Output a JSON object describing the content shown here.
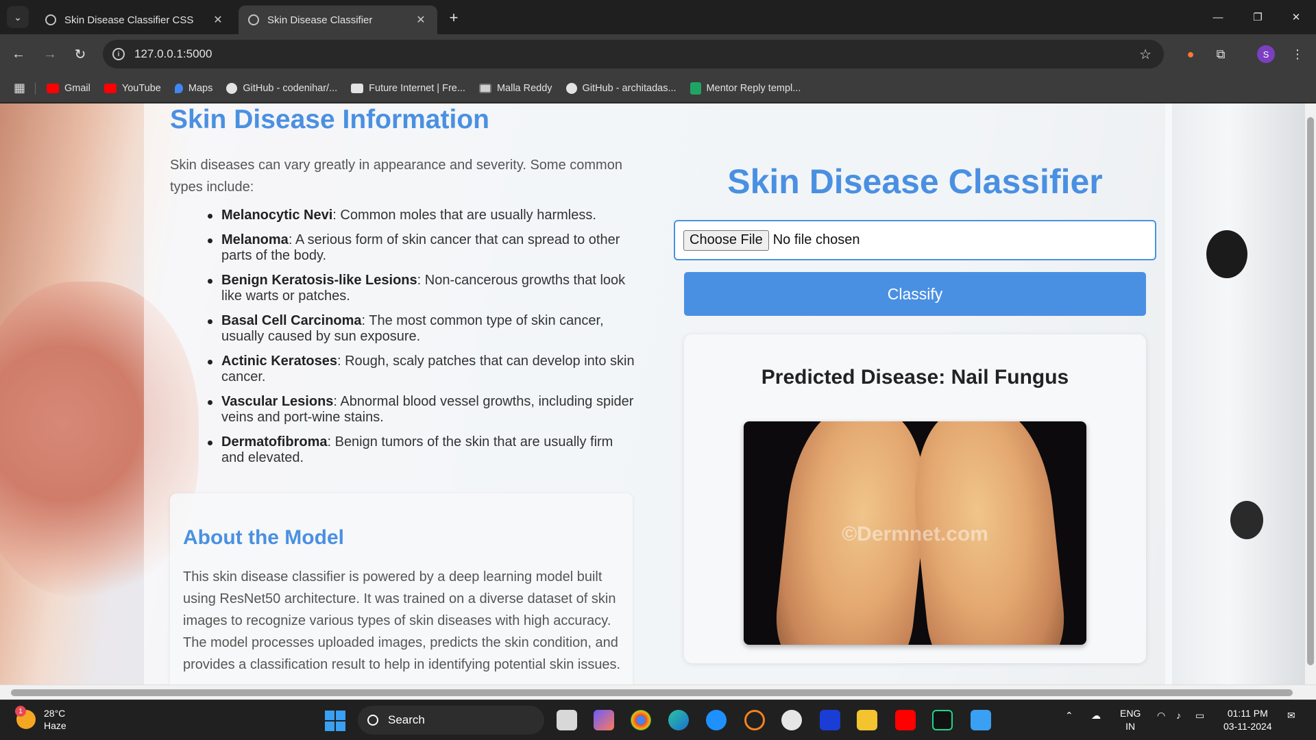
{
  "browser": {
    "tabs": [
      {
        "title": "Skin Disease Classifier CSS",
        "active": false
      },
      {
        "title": "Skin Disease Classifier",
        "active": true
      }
    ],
    "url": "127.0.0.1:5000",
    "profile_initial": "S",
    "bookmarks": [
      {
        "label": "Gmail",
        "icon": "youtube-red-icon"
      },
      {
        "label": "YouTube",
        "icon": "youtube-icon"
      },
      {
        "label": "Maps",
        "icon": "maps-icon"
      },
      {
        "label": "GitHub - codenihar/...",
        "icon": "github-icon"
      },
      {
        "label": "Future Internet | Fre...",
        "icon": "page-icon"
      },
      {
        "label": "Malla Reddy",
        "icon": "page-icon"
      },
      {
        "label": "GitHub - architadas...",
        "icon": "github-icon"
      },
      {
        "label": "Mentor Reply templ...",
        "icon": "sheets-icon"
      }
    ]
  },
  "info": {
    "title": "Skin Disease Information",
    "intro": "Skin diseases can vary greatly in appearance and severity. Some common types include:",
    "diseases": [
      {
        "name": "Melanocytic Nevi",
        "desc": ": Common moles that are usually harmless."
      },
      {
        "name": "Melanoma",
        "desc": ": A serious form of skin cancer that can spread to other parts of the body."
      },
      {
        "name": "Benign Keratosis-like Lesions",
        "desc": ": Non-cancerous growths that look like warts or patches."
      },
      {
        "name": "Basal Cell Carcinoma",
        "desc": ": The most common type of skin cancer, usually caused by sun exposure."
      },
      {
        "name": "Actinic Keratoses",
        "desc": ": Rough, scaly patches that can develop into skin cancer."
      },
      {
        "name": "Vascular Lesions",
        "desc": ": Abnormal blood vessel growths, including spider veins and port-wine stains."
      },
      {
        "name": "Dermatofibroma",
        "desc": ": Benign tumors of the skin that are usually firm and elevated."
      }
    ]
  },
  "about": {
    "title": "About the Model",
    "text": "This skin disease classifier is powered by a deep learning model built using ResNet50 architecture. It was trained on a diverse dataset of skin images to recognize various types of skin diseases with high accuracy. The model processes uploaded images, predicts the skin condition, and provides a classification result to help in identifying potential skin issues."
  },
  "classifier": {
    "title": "Skin Disease Classifier",
    "choose_file": "Choose File",
    "no_file": "No file chosen",
    "classify_label": "Classify",
    "prediction": "Predicted Disease: Nail Fungus",
    "image_watermark": "©Dermnet.com"
  },
  "taskbar": {
    "temperature": "28°C",
    "weather": "Haze",
    "weather_badge": "1",
    "search_label": "Search",
    "lang_top": "ENG",
    "lang_bottom": "IN",
    "time": "01:11 PM",
    "date": "03-11-2024"
  },
  "colors": {
    "accent": "#4a90e2"
  }
}
